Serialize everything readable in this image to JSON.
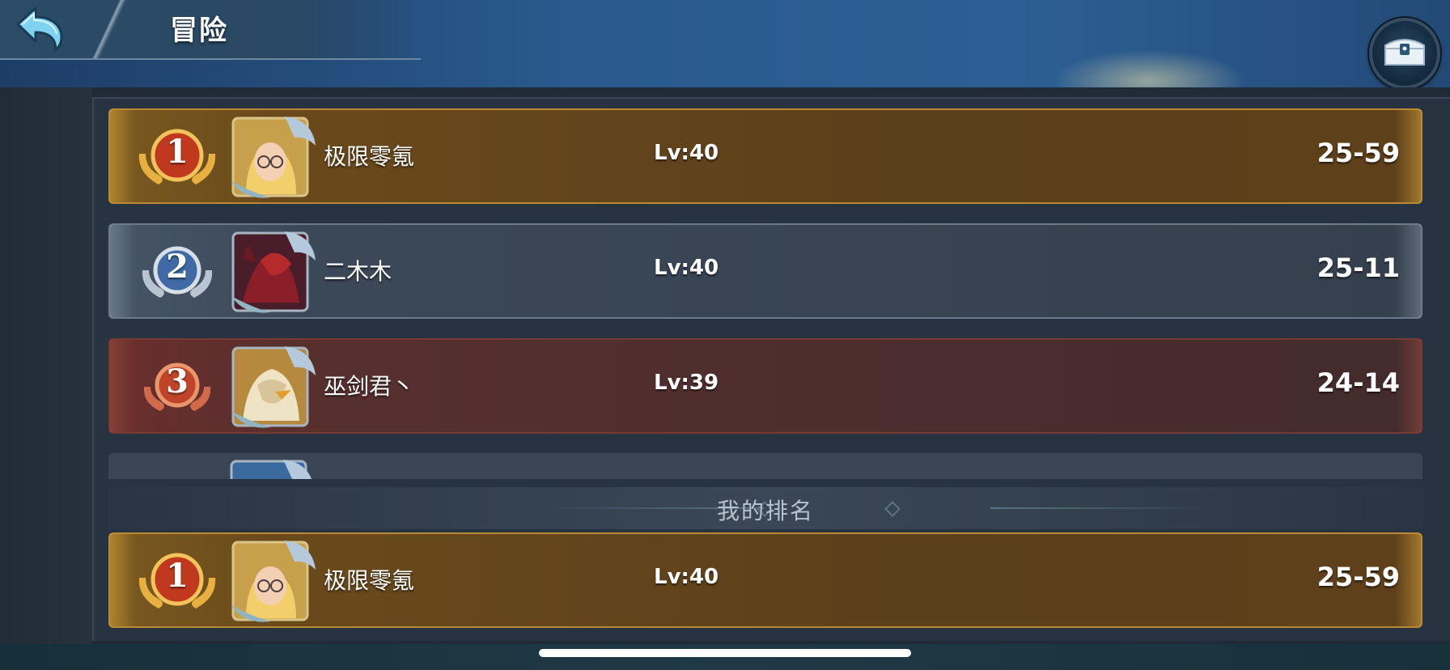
{
  "header": {
    "title": "冒险"
  },
  "leaderboard": [
    {
      "rank": "1",
      "tier": "gold",
      "name": "极限零氪",
      "level": "Lv:40",
      "score": "25-59"
    },
    {
      "rank": "2",
      "tier": "silver",
      "name": "二木木",
      "level": "Lv:40",
      "score": "25-11"
    },
    {
      "rank": "3",
      "tier": "bronze",
      "name": "巫剑君丶",
      "level": "Lv:39",
      "score": "24-14"
    }
  ],
  "my_rank": {
    "label": "我的排名",
    "rank": "1",
    "name": "极限零氪",
    "level": "Lv:40",
    "score": "25-59"
  },
  "colors": {
    "gold_row": "#5c3f1b",
    "silver_row": "#35404e",
    "bronze_row": "#432b2c"
  },
  "icons": {
    "back": "back-arrow-icon",
    "chest": "treasure-chest-icon"
  }
}
